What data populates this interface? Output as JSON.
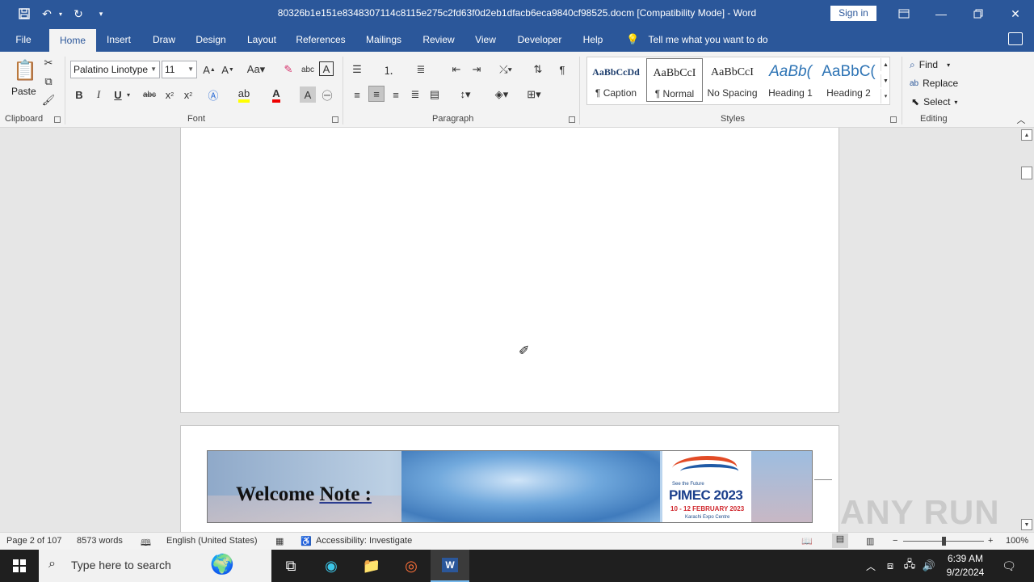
{
  "titlebar": {
    "title": "80326b1e151e8348307114c8115e275c2fd63f0d2eb1dfacb6eca9840cf98525.docm [Compatibility Mode] - Word",
    "sign_in": "Sign in"
  },
  "tabs": [
    "File",
    "Home",
    "Insert",
    "Draw",
    "Design",
    "Layout",
    "References",
    "Mailings",
    "Review",
    "View",
    "Developer",
    "Help"
  ],
  "tell_me": "Tell me what you want to do",
  "ribbon": {
    "clipboard": {
      "label": "Clipboard",
      "paste": "Paste"
    },
    "font": {
      "label": "Font",
      "font_name": "Palatino Linotype",
      "font_size": "11"
    },
    "paragraph": {
      "label": "Paragraph"
    },
    "styles": {
      "label": "Styles",
      "items": [
        {
          "sample": "AaBbCcDd",
          "name": "¶ Caption"
        },
        {
          "sample": "AaBbCcI",
          "name": "¶ Normal"
        },
        {
          "sample": "AaBbCcI",
          "name": "No Spacing"
        },
        {
          "sample": "AaBb(",
          "name": "Heading 1"
        },
        {
          "sample": "AaBbC(",
          "name": "Heading 2"
        }
      ]
    },
    "editing": {
      "label": "Editing",
      "find": "Find",
      "replace": "Replace",
      "select": "Select"
    }
  },
  "document": {
    "banner_title_a": "Welcome ",
    "banner_title_b": "Note :",
    "logo": {
      "tagline": "See the Future",
      "name": "PIMEC 2023",
      "dates": "10 - 12 FEBRUARY 2023",
      "venue": "Karachi Expo Centre"
    }
  },
  "status": {
    "page": "Page 2 of 107",
    "words": "8573 words",
    "language": "English (United States)",
    "accessibility": "Accessibility: Investigate",
    "zoom": "100%"
  },
  "taskbar": {
    "search_placeholder": "Type here to search",
    "time": "6:39 AM",
    "date": "9/2/2024"
  },
  "watermark": "ANY RUN",
  "colors": {
    "accent": "#2b579a"
  }
}
